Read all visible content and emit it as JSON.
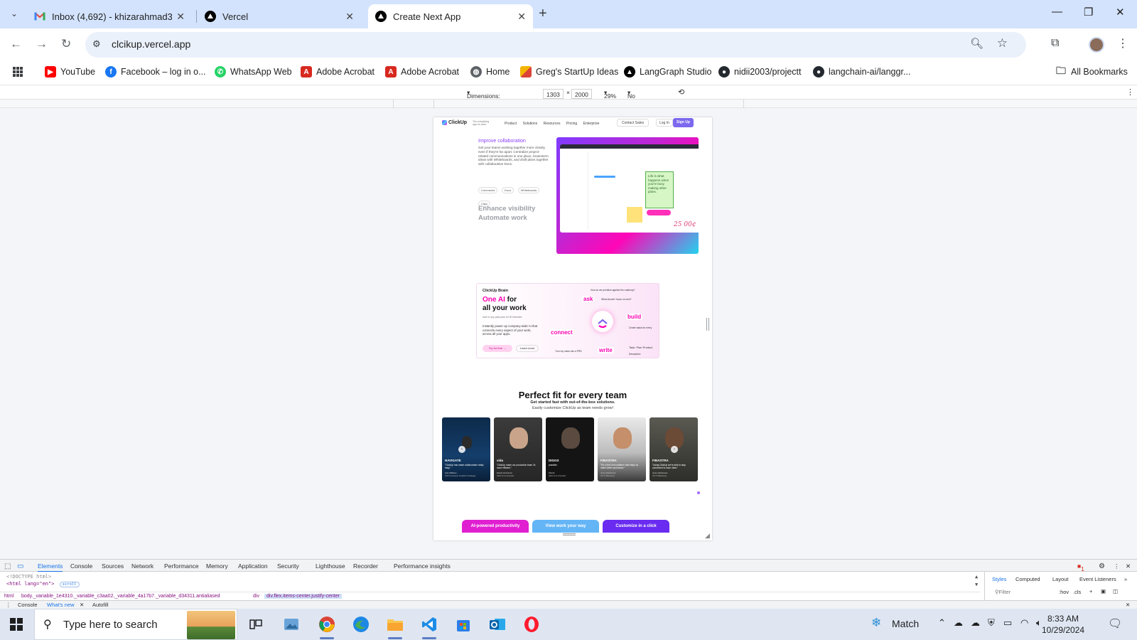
{
  "browser": {
    "tabs": [
      {
        "title": "Inbox (4,692) - khizarahmad333",
        "favicon": "gmail-icon"
      },
      {
        "title": "Vercel",
        "favicon": "vercel-icon"
      },
      {
        "title": "Create Next App",
        "favicon": "vercel-icon",
        "active": true
      }
    ],
    "url": "clcikup.vercel.app",
    "bookmarks": [
      "YouTube",
      "Facebook – log in o...",
      "WhatsApp Web",
      "Adobe Acrobat",
      "Adobe Acrobat",
      "Home",
      "Greg's StartUp Ideas",
      "LangGraph Studio",
      "nidii2003/projectt",
      "langchain-ai/langgr..."
    ],
    "all_bookmarks": "All Bookmarks"
  },
  "device_toolbar": {
    "dimensions_label": "Dimensions: Responsive",
    "width": "1303",
    "times": "×",
    "height": "2000",
    "zoom": "29%",
    "throttling": "No throttling"
  },
  "site": {
    "logo": "ClickUp",
    "tagline": "The everything app for work",
    "nav": [
      "Product",
      "Solutions",
      "Resources",
      "Pricing",
      "Enterprise"
    ],
    "contact": "Contact Sales",
    "login": "Log In",
    "signup": "Sign Up",
    "feature": {
      "heading": "Improve collaboration",
      "body": "Get your teams working together more closely, even if they're far apart. Centralize project-related communications in one place, brainstorm ideas with Whiteboards, and draft plans together with collaborative Docs.",
      "chips": [
        "Comments",
        "Docs",
        "Whiteboards",
        "Clips"
      ],
      "more1": "Enhance visibility",
      "more2": "Automate work",
      "sticky": "Life is what happens when you're busy making other plans.",
      "scribble": "25 00¢"
    },
    "brain": {
      "logo": "ClickUp Brain",
      "h_pink": "One AI",
      "h_rest1": " for",
      "h_rest2": "all your work",
      "sub": "Add to any paid plan for $7/member",
      "body": "Instantly power up company-wide AI that connects every aspect of your work, across all your apps.",
      "try": "Try for free  →",
      "learn": "Learn more",
      "words": [
        "ask",
        "build",
        "connect",
        "write"
      ],
      "prompts": [
        "How do we prioritize against the roadmap?",
        "What should I focus on next?",
        "Turn my notes into a PRD",
        "Create tasks for every",
        "Task: Plan Product",
        "Description"
      ]
    },
    "perfect_fit": {
      "title": "Perfect fit for every team",
      "sub1": "Get started fast with out-of-the-box solutions.",
      "sub2": "Easily customize ClickUp as team needs grow!",
      "cards": [
        {
          "company": "NAVIGATE",
          "quote": "\"ClickUp has made collaboration really easy.\"",
          "name": "Kyle Williams",
          "role": "SVP Consumer Insights & Strategy"
        },
        {
          "company": "vida",
          "quote": "\"ClickUp made our production team 3x more efficient.\"",
          "name": "Daniel Vennstrom",
          "role": "CEO & Co-Founder"
        },
        {
          "company": "DIGGS",
          "quote": "possible.",
          "name": "Patrick",
          "role": "CEO & Co-Founder"
        },
        {
          "company": "FINASTRA",
          "quote": "\"It's a free-form platform that helps us make better processes.\"",
          "name": "Jenny Mendonca",
          "role": "VP of Marketing"
        },
        {
          "company": "FINASTRA",
          "quote": "\"Using ClickUp we're able to stay connected to each other.\"",
          "name": "Jenny Mendonca",
          "role": "VP of Marketing"
        }
      ],
      "buttons": [
        "AI-powered productivity",
        "View work your way",
        "Customize in a click"
      ]
    }
  },
  "devtools": {
    "tabs": [
      "Elements",
      "Console",
      "Sources",
      "Network",
      "Performance",
      "Memory",
      "Application",
      "Security",
      "Lighthouse",
      "Recorder",
      "Performance insights"
    ],
    "code_line1": "<!DOCTYPE html>",
    "code_line2": "<html lang=\"en\">",
    "scroll_badge": "scroll",
    "crumbs": [
      "html",
      "body._variable_1e4310._variable_c3aa02._variable_4a17b7._variable_d34311.antialiased",
      "div",
      "div.flex.items-center.justify-center"
    ],
    "side_tabs": [
      "Styles",
      "Computed",
      "Layout",
      "Event Listeners"
    ],
    "filter": "Filter",
    "hov": ":hov",
    "cls": ".cls",
    "drawer": [
      "Console",
      "What's new",
      "Autofill"
    ],
    "error_count": "1"
  },
  "taskbar": {
    "search_placeholder": "Type here to search",
    "weather": "Match",
    "time": "8:33 AM",
    "date": "10/29/2024"
  },
  "colors": {
    "accent": "#1a73e8",
    "clickup_purple": "#7b68ee",
    "clickup_pink": "#ff02b3",
    "tabstrip": "#d3e3fd"
  }
}
